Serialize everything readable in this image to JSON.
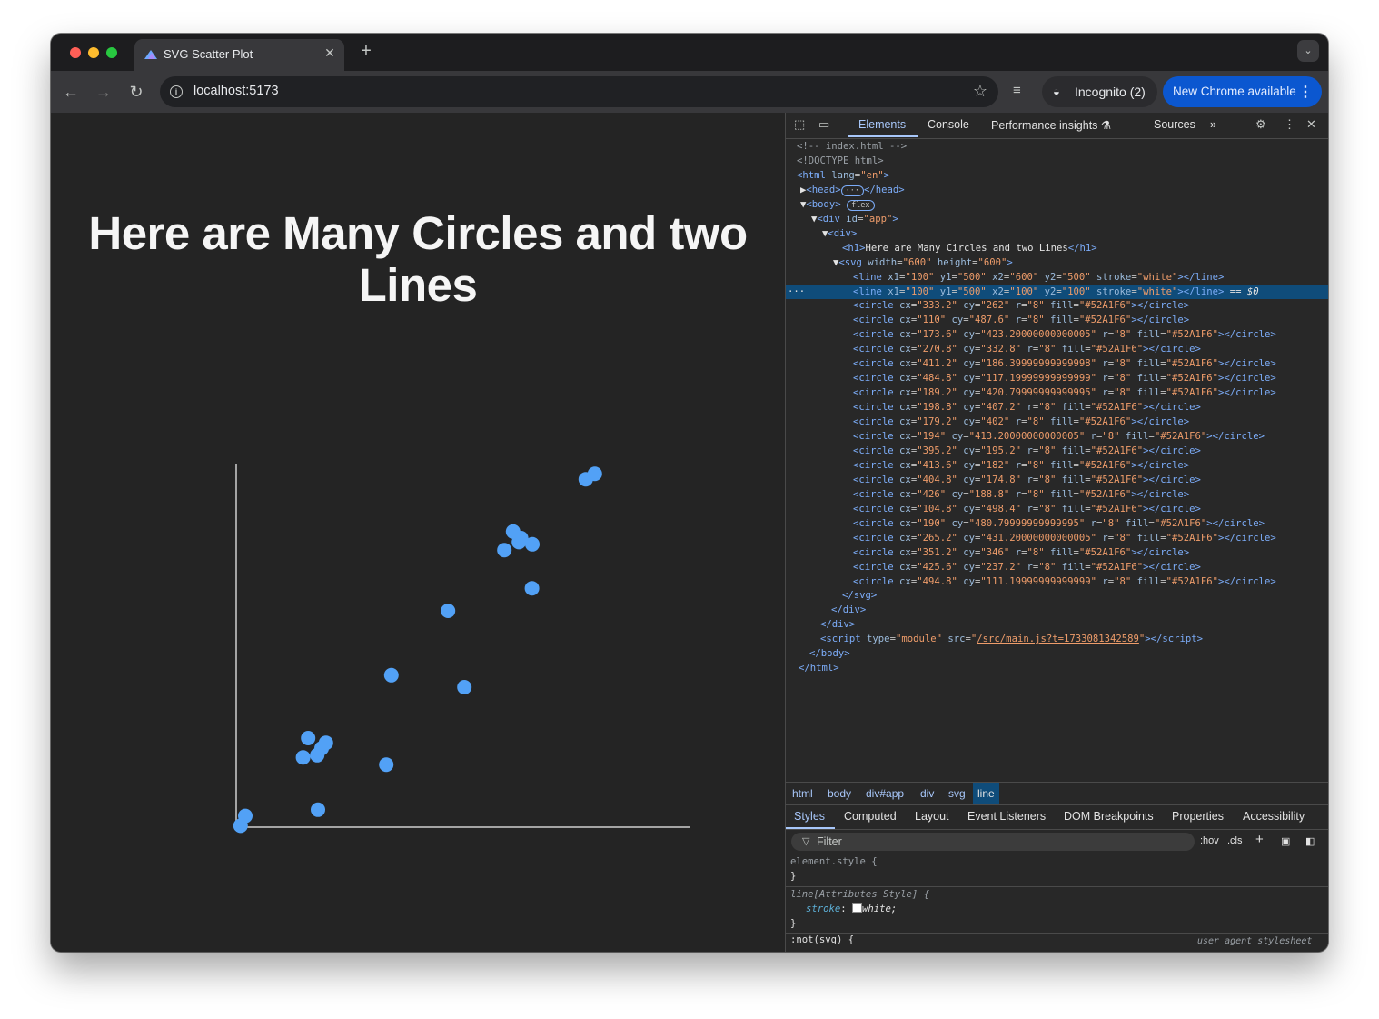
{
  "browser": {
    "tab_title": "SVG Scatter Plot",
    "tab_close": "✕",
    "new_tab": "+",
    "tab_search": "⌄",
    "url": "localhost:5173",
    "incognito_label": "Incognito (2)",
    "new_chrome_label": "New Chrome available",
    "icons": [
      "back-arrow-icon",
      "forward-arrow-icon",
      "reload-icon",
      "site-info-icon",
      "bookmark-star-icon",
      "media-control-icon",
      "incognito-icon",
      "kebab-menu-icon"
    ]
  },
  "page": {
    "heading": "Here are Many Circles and two Lines"
  },
  "chart_data": {
    "type": "scatter",
    "title": "Here are Many Circles and two Lines",
    "xlim": [
      0,
      600
    ],
    "ylim": [
      0,
      600
    ],
    "y_axis_inverted": true,
    "axis_lines": [
      {
        "x1": 100,
        "y1": 500,
        "x2": 600,
        "y2": 500,
        "stroke": "white"
      },
      {
        "x1": 100,
        "y1": 500,
        "x2": 100,
        "y2": 100,
        "stroke": "white"
      }
    ],
    "radius": 8,
    "color": "#52A1F6",
    "points": [
      {
        "x": 333.2,
        "y": 262
      },
      {
        "x": 110,
        "y": 487.6
      },
      {
        "x": 173.6,
        "y": 423.2
      },
      {
        "x": 270.8,
        "y": 332.8
      },
      {
        "x": 411.2,
        "y": 186.4
      },
      {
        "x": 484.8,
        "y": 117.2
      },
      {
        "x": 189.2,
        "y": 420.8
      },
      {
        "x": 198.8,
        "y": 407.2
      },
      {
        "x": 179.2,
        "y": 402
      },
      {
        "x": 194,
        "y": 413.2
      },
      {
        "x": 395.2,
        "y": 195.2
      },
      {
        "x": 413.6,
        "y": 182
      },
      {
        "x": 404.8,
        "y": 174.8
      },
      {
        "x": 426,
        "y": 188.8
      },
      {
        "x": 104.8,
        "y": 498.4
      },
      {
        "x": 190,
        "y": 480.8
      },
      {
        "x": 265.2,
        "y": 431.2
      },
      {
        "x": 351.2,
        "y": 346
      },
      {
        "x": 425.6,
        "y": 237.2
      },
      {
        "x": 494.8,
        "y": 111.2
      }
    ]
  },
  "devtools": {
    "tabs": [
      "Elements",
      "Console",
      "Performance insights ⚗",
      "Sources"
    ],
    "active_tab": "Elements",
    "more_tabs": "»",
    "dom_lines": [
      {
        "html": "<span class='cm'>&lt;!-- index.html --&gt;</span>"
      },
      {
        "html": "<span class='cm'>&lt;!DOCTYPE html&gt;</span>"
      },
      {
        "html": "<span class='tg'>&lt;html</span> <span class='an'>lang</span>=<span class='av'>\"en\"</span><span class='tg'>&gt;</span>"
      },
      {
        "html": "<span class='tx'>▶</span><span class='tg'>&lt;head&gt;</span><span class='badge'>···</span><span class='tg'>&lt;/head&gt;</span>"
      },
      {
        "html": "<span class='tx'>▼</span><span class='tg'>&lt;body&gt;</span> <span class='badge'>flex</span>"
      },
      {
        "html": "<span class='tx'>▼</span><span class='tg'>&lt;div</span> <span class='an'>id</span>=<span class='av'>\"app\"</span><span class='tg'>&gt;</span>"
      },
      {
        "html": "<span class='tx'>▼</span><span class='tg'>&lt;div&gt;</span>"
      },
      {
        "html": "<span class='tg'>&lt;h1&gt;</span><span class='tx'>Here are Many Circles and two Lines</span><span class='tg'>&lt;/h1&gt;</span>"
      },
      {
        "html": "<span class='tx'>▼</span><span class='tg'>&lt;svg</span> <span class='an'>width</span>=<span class='av'>\"600\"</span> <span class='an'>height</span>=<span class='av'>\"600\"</span><span class='tg'>&gt;</span>"
      },
      {
        "html": "<span class='tg'>&lt;line</span> <span class='an'>x1</span>=<span class='av'>\"100\"</span> <span class='an'>y1</span>=<span class='av'>\"500\"</span> <span class='an'>x2</span>=<span class='av'>\"600\"</span> <span class='an'>y2</span>=<span class='av'>\"500\"</span> <span class='an'>stroke</span>=<span class='av'>\"white\"</span><span class='tg'>&gt;&lt;/line&gt;</span>"
      },
      {
        "html": "<span class='tg'>&lt;line</span> <span class='an'>x1</span>=<span class='av'>\"100\"</span> <span class='an'>y1</span>=<span class='av'>\"500\"</span> <span class='an'>x2</span>=<span class='av'>\"100\"</span> <span class='an'>y2</span>=<span class='av'>\"100\"</span> <span class='an'>stroke</span>=<span class='av'>\"white\"</span><span class='tg'>&gt;&lt;/line&gt;</span> <span class='tx'>== <i>$0</i></span>",
        "selected": true
      },
      {
        "html": "<span class='tg'>&lt;circle</span> <span class='an'>cx</span>=<span class='av'>\"333.2\"</span> <span class='an'>cy</span>=<span class='av'>\"262\"</span> <span class='an'>r</span>=<span class='av'>\"8\"</span> <span class='an'>fill</span>=<span class='av'>\"#52A1F6\"</span><span class='tg'>&gt;&lt;/circle&gt;</span>"
      },
      {
        "html": "<span class='tg'>&lt;circle</span> <span class='an'>cx</span>=<span class='av'>\"110\"</span> <span class='an'>cy</span>=<span class='av'>\"487.6\"</span> <span class='an'>r</span>=<span class='av'>\"8\"</span> <span class='an'>fill</span>=<span class='av'>\"#52A1F6\"</span><span class='tg'>&gt;&lt;/circle&gt;</span>"
      },
      {
        "html": "<span class='tg'>&lt;circle</span> <span class='an'>cx</span>=<span class='av'>\"173.6\"</span> <span class='an'>cy</span>=<span class='av'>\"423.20000000000005\"</span> <span class='an'>r</span>=<span class='av'>\"8\"</span> <span class='an'>fill</span>=<span class='av'>\"#52A1F6\"</span><span class='tg'>&gt;&lt;/circle&gt;</span>"
      },
      {
        "html": "<span class='tg'>&lt;circle</span> <span class='an'>cx</span>=<span class='av'>\"270.8\"</span> <span class='an'>cy</span>=<span class='av'>\"332.8\"</span> <span class='an'>r</span>=<span class='av'>\"8\"</span> <span class='an'>fill</span>=<span class='av'>\"#52A1F6\"</span><span class='tg'>&gt;&lt;/circle&gt;</span>"
      },
      {
        "html": "<span class='tg'>&lt;circle</span> <span class='an'>cx</span>=<span class='av'>\"411.2\"</span> <span class='an'>cy</span>=<span class='av'>\"186.39999999999998\"</span> <span class='an'>r</span>=<span class='av'>\"8\"</span> <span class='an'>fill</span>=<span class='av'>\"#52A1F6\"</span><span class='tg'>&gt;&lt;/circle&gt;</span>"
      },
      {
        "html": "<span class='tg'>&lt;circle</span> <span class='an'>cx</span>=<span class='av'>\"484.8\"</span> <span class='an'>cy</span>=<span class='av'>\"117.19999999999999\"</span> <span class='an'>r</span>=<span class='av'>\"8\"</span> <span class='an'>fill</span>=<span class='av'>\"#52A1F6\"</span><span class='tg'>&gt;&lt;/circle&gt;</span>"
      },
      {
        "html": "<span class='tg'>&lt;circle</span> <span class='an'>cx</span>=<span class='av'>\"189.2\"</span> <span class='an'>cy</span>=<span class='av'>\"420.79999999999995\"</span> <span class='an'>r</span>=<span class='av'>\"8\"</span> <span class='an'>fill</span>=<span class='av'>\"#52A1F6\"</span><span class='tg'>&gt;&lt;/circle&gt;</span>"
      },
      {
        "html": "<span class='tg'>&lt;circle</span> <span class='an'>cx</span>=<span class='av'>\"198.8\"</span> <span class='an'>cy</span>=<span class='av'>\"407.2\"</span> <span class='an'>r</span>=<span class='av'>\"8\"</span> <span class='an'>fill</span>=<span class='av'>\"#52A1F6\"</span><span class='tg'>&gt;&lt;/circle&gt;</span>"
      },
      {
        "html": "<span class='tg'>&lt;circle</span> <span class='an'>cx</span>=<span class='av'>\"179.2\"</span> <span class='an'>cy</span>=<span class='av'>\"402\"</span> <span class='an'>r</span>=<span class='av'>\"8\"</span> <span class='an'>fill</span>=<span class='av'>\"#52A1F6\"</span><span class='tg'>&gt;&lt;/circle&gt;</span>"
      },
      {
        "html": "<span class='tg'>&lt;circle</span> <span class='an'>cx</span>=<span class='av'>\"194\"</span> <span class='an'>cy</span>=<span class='av'>\"413.20000000000005\"</span> <span class='an'>r</span>=<span class='av'>\"8\"</span> <span class='an'>fill</span>=<span class='av'>\"#52A1F6\"</span><span class='tg'>&gt;&lt;/circle&gt;</span>"
      },
      {
        "html": "<span class='tg'>&lt;circle</span> <span class='an'>cx</span>=<span class='av'>\"395.2\"</span> <span class='an'>cy</span>=<span class='av'>\"195.2\"</span> <span class='an'>r</span>=<span class='av'>\"8\"</span> <span class='an'>fill</span>=<span class='av'>\"#52A1F6\"</span><span class='tg'>&gt;&lt;/circle&gt;</span>"
      },
      {
        "html": "<span class='tg'>&lt;circle</span> <span class='an'>cx</span>=<span class='av'>\"413.6\"</span> <span class='an'>cy</span>=<span class='av'>\"182\"</span> <span class='an'>r</span>=<span class='av'>\"8\"</span> <span class='an'>fill</span>=<span class='av'>\"#52A1F6\"</span><span class='tg'>&gt;&lt;/circle&gt;</span>"
      },
      {
        "html": "<span class='tg'>&lt;circle</span> <span class='an'>cx</span>=<span class='av'>\"404.8\"</span> <span class='an'>cy</span>=<span class='av'>\"174.8\"</span> <span class='an'>r</span>=<span class='av'>\"8\"</span> <span class='an'>fill</span>=<span class='av'>\"#52A1F6\"</span><span class='tg'>&gt;&lt;/circle&gt;</span>"
      },
      {
        "html": "<span class='tg'>&lt;circle</span> <span class='an'>cx</span>=<span class='av'>\"426\"</span> <span class='an'>cy</span>=<span class='av'>\"188.8\"</span> <span class='an'>r</span>=<span class='av'>\"8\"</span> <span class='an'>fill</span>=<span class='av'>\"#52A1F6\"</span><span class='tg'>&gt;&lt;/circle&gt;</span>"
      },
      {
        "html": "<span class='tg'>&lt;circle</span> <span class='an'>cx</span>=<span class='av'>\"104.8\"</span> <span class='an'>cy</span>=<span class='av'>\"498.4\"</span> <span class='an'>r</span>=<span class='av'>\"8\"</span> <span class='an'>fill</span>=<span class='av'>\"#52A1F6\"</span><span class='tg'>&gt;&lt;/circle&gt;</span>"
      },
      {
        "html": "<span class='tg'>&lt;circle</span> <span class='an'>cx</span>=<span class='av'>\"190\"</span> <span class='an'>cy</span>=<span class='av'>\"480.79999999999995\"</span> <span class='an'>r</span>=<span class='av'>\"8\"</span> <span class='an'>fill</span>=<span class='av'>\"#52A1F6\"</span><span class='tg'>&gt;&lt;/circle&gt;</span>"
      },
      {
        "html": "<span class='tg'>&lt;circle</span> <span class='an'>cx</span>=<span class='av'>\"265.2\"</span> <span class='an'>cy</span>=<span class='av'>\"431.20000000000005\"</span> <span class='an'>r</span>=<span class='av'>\"8\"</span> <span class='an'>fill</span>=<span class='av'>\"#52A1F6\"</span><span class='tg'>&gt;&lt;/circle&gt;</span>"
      },
      {
        "html": "<span class='tg'>&lt;circle</span> <span class='an'>cx</span>=<span class='av'>\"351.2\"</span> <span class='an'>cy</span>=<span class='av'>\"346\"</span> <span class='an'>r</span>=<span class='av'>\"8\"</span> <span class='an'>fill</span>=<span class='av'>\"#52A1F6\"</span><span class='tg'>&gt;&lt;/circle&gt;</span>"
      },
      {
        "html": "<span class='tg'>&lt;circle</span> <span class='an'>cx</span>=<span class='av'>\"425.6\"</span> <span class='an'>cy</span>=<span class='av'>\"237.2\"</span> <span class='an'>r</span>=<span class='av'>\"8\"</span> <span class='an'>fill</span>=<span class='av'>\"#52A1F6\"</span><span class='tg'>&gt;&lt;/circle&gt;</span>"
      },
      {
        "html": "<span class='tg'>&lt;circle</span> <span class='an'>cx</span>=<span class='av'>\"494.8\"</span> <span class='an'>cy</span>=<span class='av'>\"111.19999999999999\"</span> <span class='an'>r</span>=<span class='av'>\"8\"</span> <span class='an'>fill</span>=<span class='av'>\"#52A1F6\"</span><span class='tg'>&gt;&lt;/circle&gt;</span>"
      },
      {
        "html": "<span class='tg'>&lt;/svg&gt;</span>"
      },
      {
        "html": "<span class='tg'>&lt;/div&gt;</span>"
      },
      {
        "html": "<span class='tg'>&lt;/div&gt;</span>"
      },
      {
        "html": "<span class='tg'>&lt;script</span> <span class='an'>type</span>=<span class='av'>\"module\"</span> <span class='an'>src</span>=<span class='av'>\"<u>/src/main.js?t=1733081342589</u>\"</span><span class='tg'>&gt;&lt;/script&gt;</span>"
      },
      {
        "html": "<span class='tg'>&lt;/body&gt;</span>"
      },
      {
        "html": "<span class='tg'>&lt;/html&gt;</span>"
      }
    ],
    "breadcrumbs": [
      "html",
      "body",
      "div#app",
      "div",
      "svg",
      "line"
    ],
    "style_tabs": [
      "Styles",
      "Computed",
      "Layout",
      "Event Listeners",
      "DOM Breakpoints",
      "Properties",
      "Accessibility"
    ],
    "filter_placeholder": "Filter",
    "hov_label": ":hov",
    "cls_label": ".cls",
    "styles": {
      "element_style": "element.style {",
      "close_brace": "}",
      "attr_selector": "line[Attributes Style] {",
      "stroke_prop": "stroke",
      "stroke_value": "white;",
      "not_svg_selector": ":not(svg) {",
      "user_agent": "user agent stylesheet"
    }
  }
}
